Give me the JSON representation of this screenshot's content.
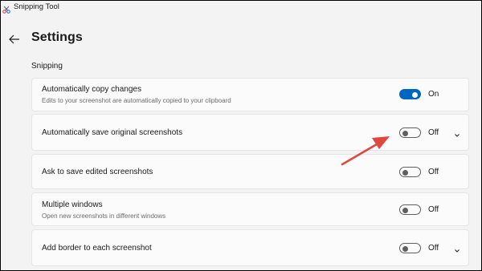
{
  "app": {
    "title": "Snipping Tool"
  },
  "page": {
    "title": "Settings",
    "section": "Snipping"
  },
  "settings": [
    {
      "title": "Automatically copy changes",
      "subtitle": "Edits to your screenshot are automatically copied to your clipboard",
      "state": "On"
    },
    {
      "title": "Automatically save original screenshots",
      "state": "Off"
    },
    {
      "title": "Ask to save edited screenshots",
      "state": "Off"
    },
    {
      "title": "Multiple windows",
      "subtitle": "Open new screenshots in different windows",
      "state": "Off"
    },
    {
      "title": "Add border to each screenshot",
      "state": "Off"
    }
  ],
  "colors": {
    "accent": "#0067c0",
    "annotation_arrow": "#e0473f",
    "page_bg": "#f3f3f3",
    "card_bg": "#fbfbfb"
  }
}
